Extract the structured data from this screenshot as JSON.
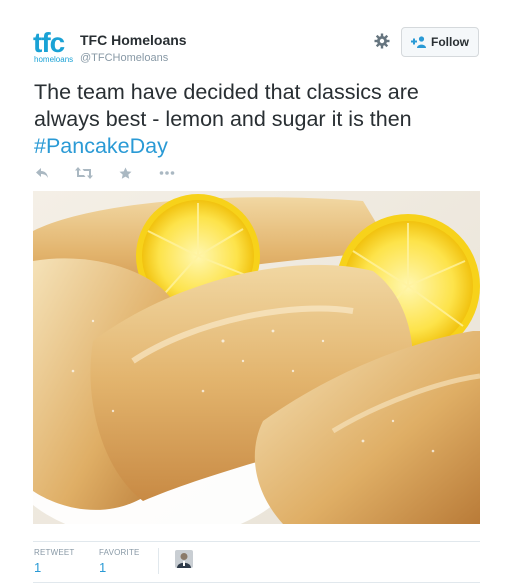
{
  "author": {
    "logo_text": "tfc",
    "logo_subtext": "homeloans",
    "fullname": "TFC Homeloans",
    "screen_name": "@TFCHomeloans"
  },
  "header_actions": {
    "settings_icon": "gear-icon",
    "follow_label": "Follow",
    "follow_icon": "follow-user-icon"
  },
  "tweet": {
    "text": "The team have decided that classics are always best - lemon and sugar it is then",
    "hashtag": "#PancakeDay"
  },
  "actions": [
    {
      "name": "reply-icon"
    },
    {
      "name": "retweet-icon"
    },
    {
      "name": "favorite-icon"
    },
    {
      "name": "more-icon"
    }
  ],
  "media": {
    "description_icon": "photo"
  },
  "stats": {
    "retweet_label": "RETWEET",
    "retweet_count": "1",
    "favorite_label": "FAVORITE",
    "favorite_count": "1"
  },
  "colors": {
    "brand": "#1aa2d5",
    "link": "#2a9ad5",
    "text": "#292f33",
    "muted": "#8899a6"
  }
}
